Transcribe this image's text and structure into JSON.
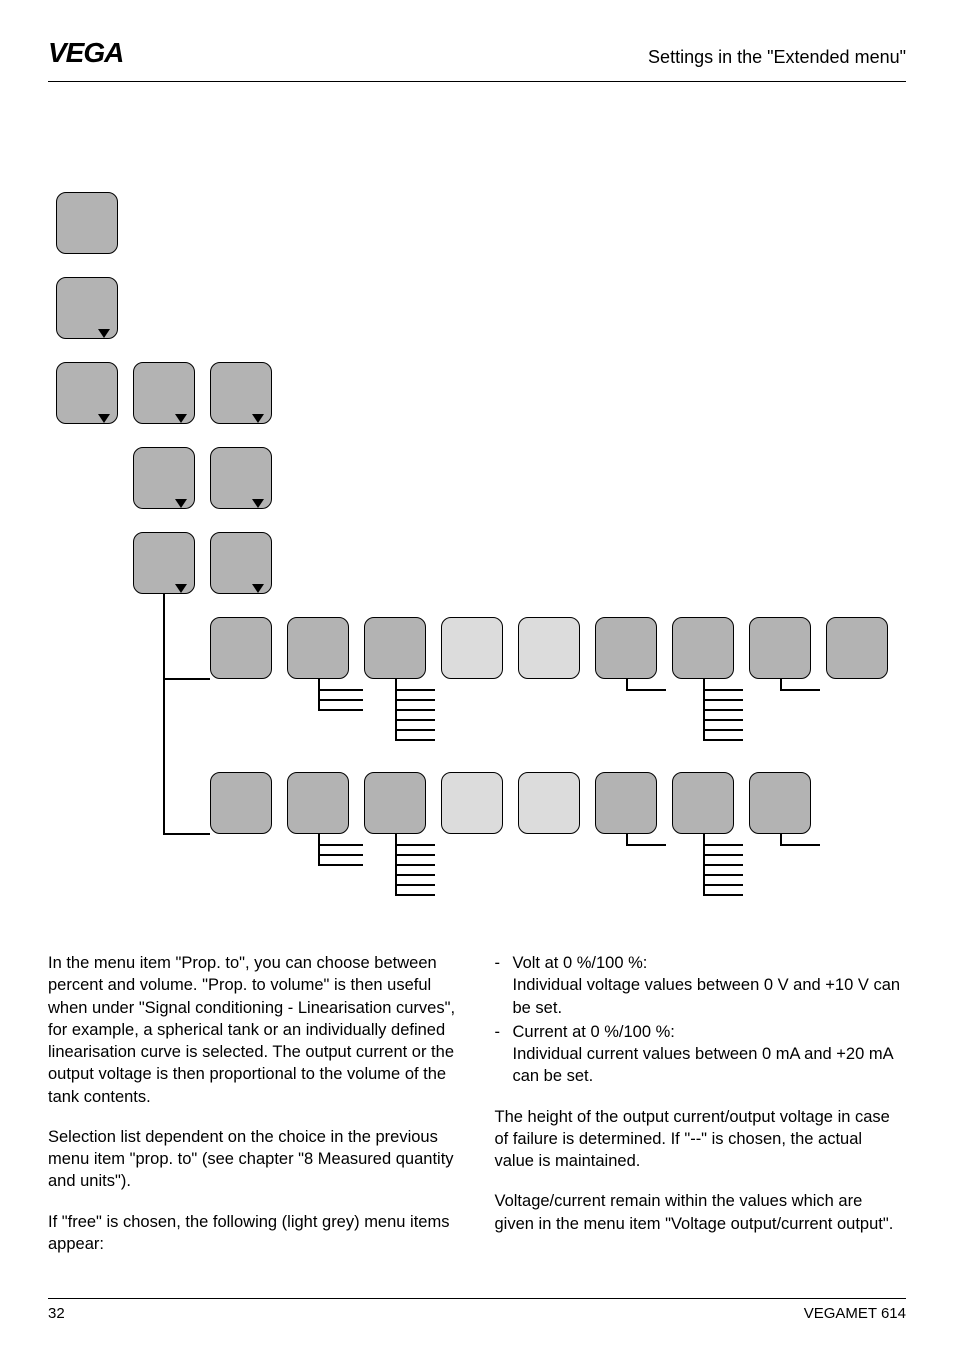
{
  "header_title": "Settings in the \"Extended menu\"",
  "logo_text": "VEGA",
  "col1": {
    "p1": "In the menu item \"Prop. to\", you can choose between percent and volume. \"Prop. to volume\" is then useful when under \"Signal conditioning - Linearisation curves\", for example, a spherical tank or an individually defined linearisation curve is selected. The output current or the output voltage is then proportional to the volume of the tank contents.",
    "p2": "Selection list dependent on the choice in the previous menu item \"prop. to\" (see chapter \"8 Measured quantity and units\").",
    "p3": "If \"free\" is chosen, the following (light grey) menu items appear:"
  },
  "col2": {
    "b1_title": "Volt at 0 %/100 %:",
    "b1_body": "Individual voltage values between 0 V and +10 V can be set.",
    "b2_title": "Current at 0 %/100 %:",
    "b2_body": "Individual current values between 0 mA and +20 mA can be set.",
    "p1": "The height of the output current/output voltage in case of failure is determined. If \"--\" is chosen, the actual value is maintained.",
    "p2": "Voltage/current remain within the values which are given in the menu item \"Voltage output/current output\"."
  },
  "footer": {
    "page": "32",
    "doc": "VEGAMET 614"
  }
}
